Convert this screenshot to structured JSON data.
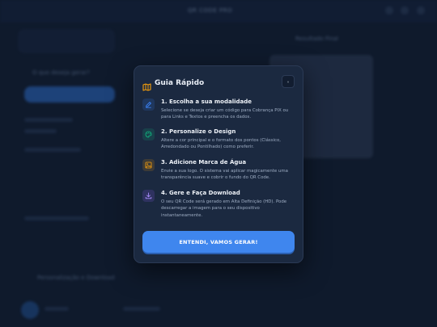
{
  "background": {
    "brand": "QR CODE PRO",
    "section_title": "O que deseja gerar?",
    "preview_title": "Resultado Final",
    "download_section": "Personalização e Download"
  },
  "modal": {
    "title": "Guia Rápido",
    "steps": [
      {
        "title": "1. Escolha a sua modalidade",
        "description": "Selecione se deseja criar um código para Cobrança PIX ou para Links e Textos e preencha os dados.",
        "icon": "pencil-icon",
        "accent": "#3b82f6"
      },
      {
        "title": "2. Personalize o Design",
        "description": "Altere a cor principal e o formato dos pontos (Clássico, Arredondado ou Pontilhado) como preferir.",
        "icon": "palette-icon",
        "accent": "#10b981"
      },
      {
        "title": "3. Adicione Marca de Água",
        "description": "Envie a sua logo. O sistema vai aplicar magicamente uma transparência suave e cobrir o fundo do QR Code.",
        "icon": "image-icon",
        "accent": "#f59e0b"
      },
      {
        "title": "4. Gere e Faça Download",
        "description": "O seu QR Code será gerado em Alta Definição (HD). Pode descarregar a imagem para o seu dispositivo instantaneamente.",
        "icon": "download-icon",
        "accent": "#8b5cf6"
      }
    ],
    "cta_label": "ENTENDI, VAMOS GERAR!"
  },
  "colors": {
    "accent": "#3f86ee",
    "modal_bg": "#1b2940",
    "title_icon": "#f59e0b"
  }
}
